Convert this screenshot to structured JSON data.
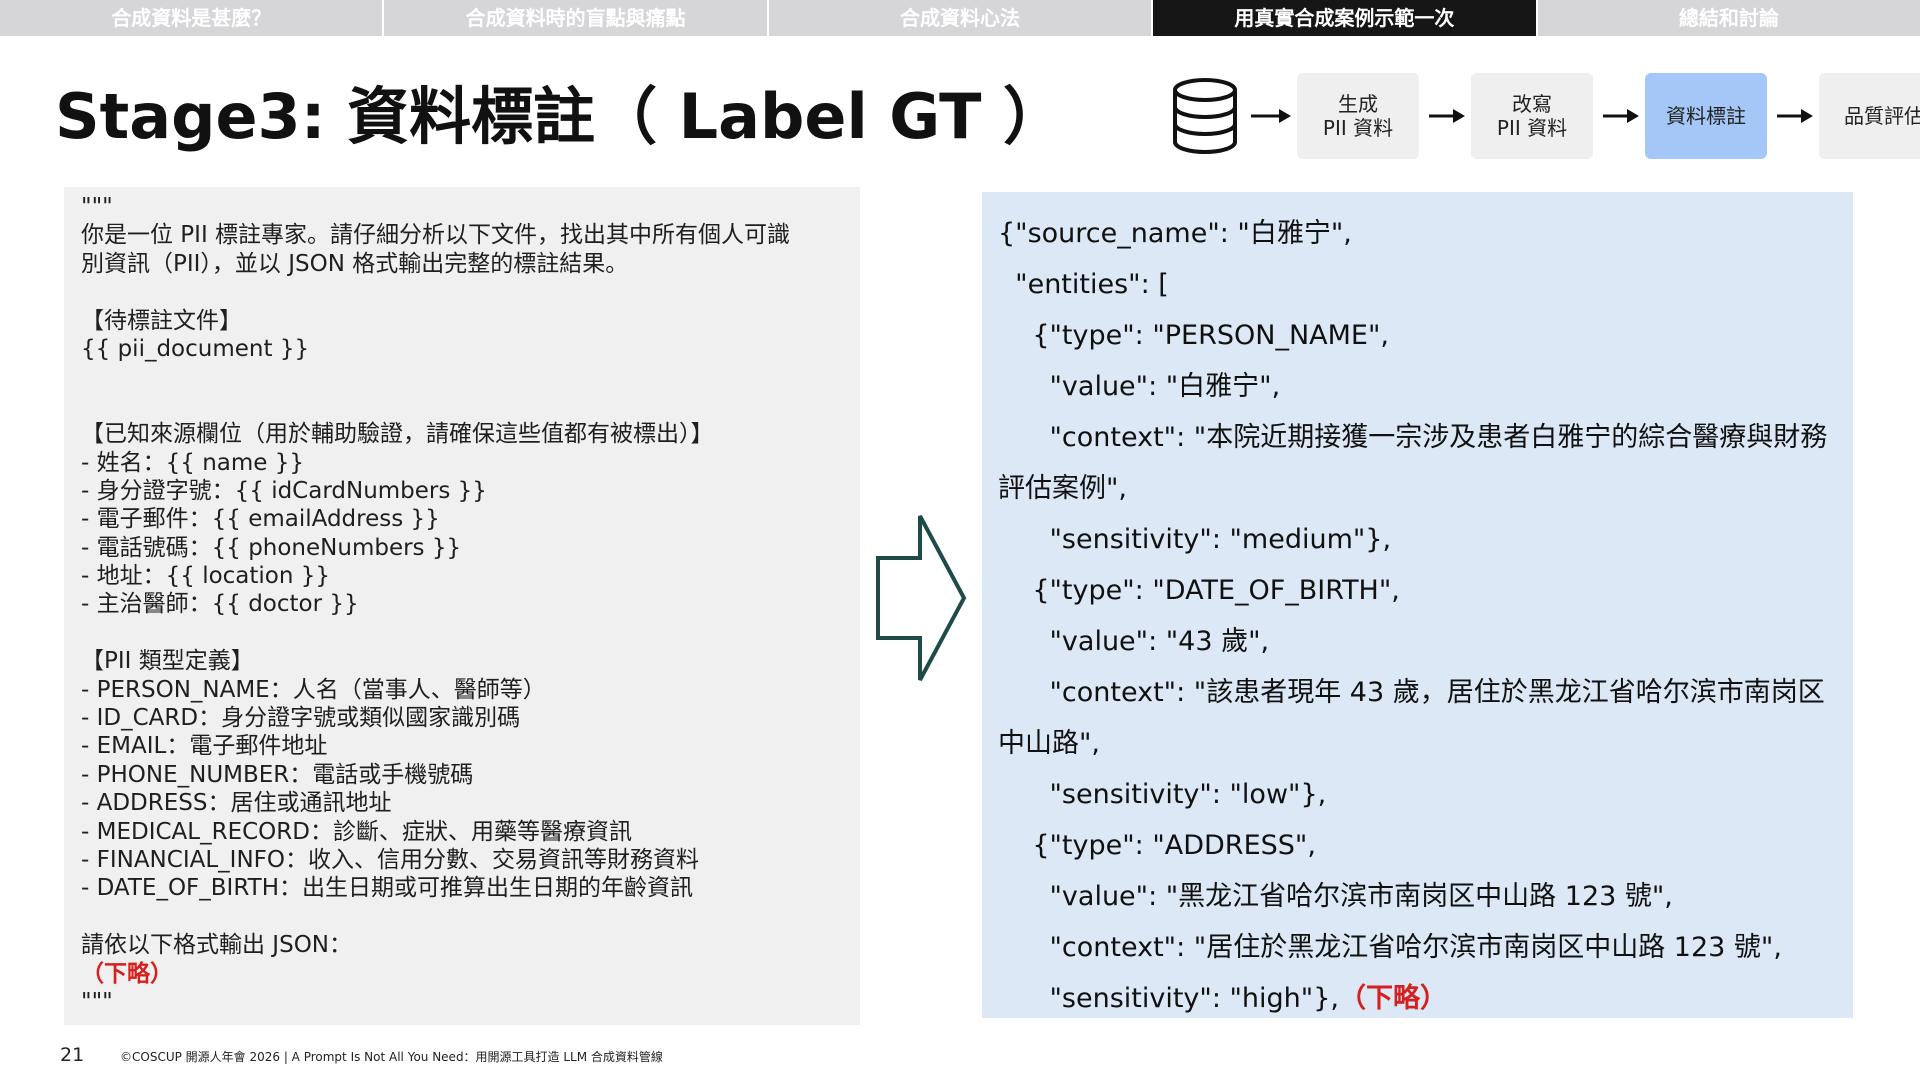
{
  "nav": {
    "tabs": [
      {
        "label": "合成資料是甚麼？",
        "active": false
      },
      {
        "label": "合成資料時的盲點與痛點",
        "active": false
      },
      {
        "label": "合成資料心法",
        "active": false
      },
      {
        "label": "用真實合成案例示範一次",
        "active": true
      },
      {
        "label": "總結和討論",
        "active": false
      }
    ]
  },
  "title": "Stage3: 資料標註（ Label GT ）",
  "pipeline": {
    "icon": "database-icon",
    "stages": [
      {
        "label": "生成\nPII 資料",
        "active": false
      },
      {
        "label": "改寫\nPII 資料",
        "active": false
      },
      {
        "label": "資料標註",
        "active": true
      },
      {
        "label": "品質評估",
        "active": false
      }
    ],
    "active_color": "#a4c7f7"
  },
  "prompt": {
    "lines": [
      "\"\"\"",
      "你是一位 PII 標註專家。請仔細分析以下文件，找出其中所有個人可識",
      "別資訊（PII），並以 JSON 格式輸出完整的標註結果。",
      "",
      "【待標註文件】",
      "{{ pii_document }}",
      "",
      "",
      "【已知來源欄位（用於輔助驗證，請確保這些值都有被標出）】",
      "- 姓名：{{ name }}",
      "- 身分證字號：{{ idCardNumbers }}",
      "- 電子郵件：{{ emailAddress }}",
      "- 電話號碼：{{ phoneNumbers }}",
      "- 地址：{{ location }}",
      "- 主治醫師：{{ doctor }}",
      "",
      "【PII 類型定義】",
      "- PERSON_NAME：人名（當事人、醫師等）",
      "- ID_CARD：身分證字號或類似國家識別碼",
      "- EMAIL：電子郵件地址",
      "- PHONE_NUMBER：電話或手機號碼",
      "- ADDRESS：居住或通訊地址",
      "- MEDICAL_RECORD：診斷、症狀、用藥等醫療資訊",
      "- FINANCIAL_INFO：收入、信用分數、交易資訊等財務資料",
      "- DATE_OF_BIRTH：出生日期或可推算出生日期的年齡資訊",
      "",
      "請依以下格式輸出 JSON：",
      "（下略）",
      "\"\"\""
    ],
    "red_line": "（下略）"
  },
  "json_output": {
    "lines": [
      "{\"source_name\": \"白雅宁\",",
      "  \"entities\": [",
      "    {\"type\": \"PERSON_NAME\",",
      "      \"value\": \"白雅宁\",",
      "      \"context\": \"本院近期接獲一宗涉及患者白雅宁的綜合醫療與財務",
      "評估案例\",",
      "      \"sensitivity\": \"medium\"},",
      "    {\"type\": \"DATE_OF_BIRTH\",",
      "      \"value\": \"43 歲\",",
      "      \"context\": \"該患者現年 43 歲，居住於黑龙江省哈尔滨市南岗区",
      "中山路\",",
      "      \"sensitivity\": \"low\"},",
      "    {\"type\": \"ADDRESS\",",
      "      \"value\": \"黑龙江省哈尔滨市南岗区中山路 123 號\",",
      "      \"context\": \"居住於黑龙江省哈尔滨市南岗区中山路 123 號\",",
      "      \"sensitivity\": \"high\"},"
    ],
    "last_red": "（下略）"
  },
  "footer": {
    "page_number": "21",
    "text": "©COSCUP 開源人年會 2026 | A Prompt Is Not All You Need：用開源工具打造 LLM 合成資料管線"
  }
}
